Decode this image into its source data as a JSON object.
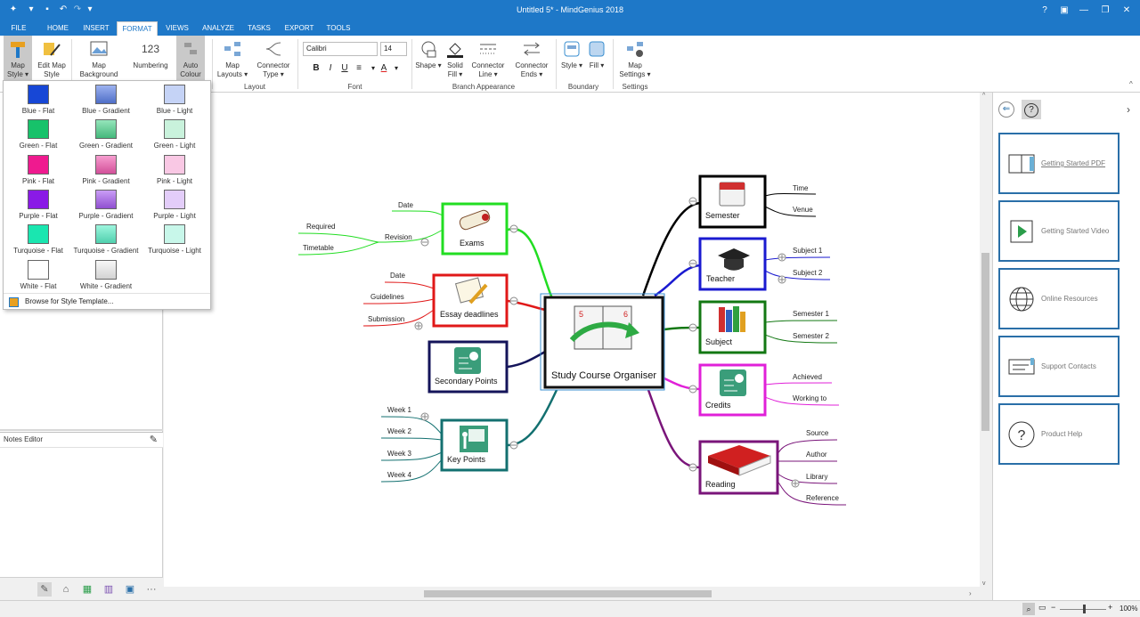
{
  "window": {
    "title": "Untitled 5* - MindGenius 2018"
  },
  "tabs": [
    "FILE",
    "HOME",
    "INSERT",
    "FORMAT",
    "VIEWS",
    "ANALYZE",
    "TASKS",
    "EXPORT",
    "TOOLS"
  ],
  "active_tab": "FORMAT",
  "ribbon": {
    "map_style": "Map Style ▾",
    "edit_map_style": "Edit Map Style",
    "map_background": "Map Background",
    "numbering": "Numbering",
    "numbering_glyph": "123",
    "auto_colour": "Auto Colour",
    "map_layouts": "Map Layouts ▾",
    "connector_type": "Connector Type ▾",
    "group_layout": "Layout",
    "font_name": "Calibri",
    "font_size": "14",
    "group_font": "Font",
    "shape": "Shape ▾",
    "solid_fill": "Solid Fill ▾",
    "connector_line": "Connector Line ▾",
    "connector_ends": "Connector Ends ▾",
    "group_branch": "Branch Appearance",
    "style": "Style ▾",
    "fill": "Fill ▾",
    "group_boundary": "Boundary",
    "map_settings": "Map Settings ▾",
    "group_settings": "Settings"
  },
  "style_menu": {
    "items": [
      {
        "label": "Blue - Flat",
        "color": "#1747d6"
      },
      {
        "label": "Blue - Gradient",
        "color": "#5b7fe6"
      },
      {
        "label": "Blue - Light",
        "color": "#c5d3f6"
      },
      {
        "label": "Green - Flat",
        "color": "#17c26a"
      },
      {
        "label": "Green - Gradient",
        "color": "#4fd48e"
      },
      {
        "label": "Green - Light",
        "color": "#c9f2dc"
      },
      {
        "label": "Pink - Flat",
        "color": "#ef1a8f"
      },
      {
        "label": "Pink - Gradient",
        "color": "#f25cb0"
      },
      {
        "label": "Pink - Light",
        "color": "#f9c8e4"
      },
      {
        "label": "Purple - Flat",
        "color": "#8a1ae6"
      },
      {
        "label": "Purple - Gradient",
        "color": "#a65cf0"
      },
      {
        "label": "Purple - Light",
        "color": "#e3cdf9"
      },
      {
        "label": "Turquoise - Flat",
        "color": "#1ae6b0"
      },
      {
        "label": "Turquoise - Gradient",
        "color": "#5cf0c8"
      },
      {
        "label": "Turquoise - Light",
        "color": "#c8f7ea"
      },
      {
        "label": "White - Flat",
        "color": "#ffffff"
      },
      {
        "label": "White - Gradient",
        "color": "#f3f3f3"
      }
    ],
    "browse": "Browse for Style Template..."
  },
  "notes_editor": {
    "title": "Notes Editor"
  },
  "mindmap": {
    "central": "Study Course Organiser",
    "left_branches": [
      {
        "label": "Exams",
        "color": "#22dd22",
        "subs": [
          "Date",
          "Revision",
          "Required",
          "Timetable"
        ]
      },
      {
        "label": "Essay deadlines",
        "color": "#e01818",
        "subs": [
          "Date",
          "Guidelines",
          "Submission"
        ]
      },
      {
        "label": "Secondary Points",
        "color": "#14145a",
        "subs": []
      },
      {
        "label": "Key Points",
        "color": "#137070",
        "subs": [
          "Week 1",
          "Week 2",
          "Week 3",
          "Week 4"
        ]
      }
    ],
    "right_branches": [
      {
        "label": "Semester",
        "color": "#000000",
        "subs": [
          "Time",
          "Venue"
        ]
      },
      {
        "label": "Teacher",
        "color": "#1a1ad0",
        "subs": [
          "Subject 1",
          "Subject 2"
        ]
      },
      {
        "label": "Subject",
        "color": "#137813",
        "subs": [
          "Semester 1",
          "Semester 2"
        ]
      },
      {
        "label": "Credits",
        "color": "#e020d8",
        "subs": [
          "Achieved",
          "Working to"
        ]
      },
      {
        "label": "Reading",
        "color": "#7a157a",
        "subs": [
          "Source",
          "Author",
          "Library",
          "Reference"
        ]
      }
    ]
  },
  "right_pane": {
    "cards": [
      "Getting Started PDF",
      "Getting Started Video",
      "Online Resources",
      "Support Contacts",
      "Product Help"
    ]
  },
  "status": {
    "zoom": "100%"
  }
}
